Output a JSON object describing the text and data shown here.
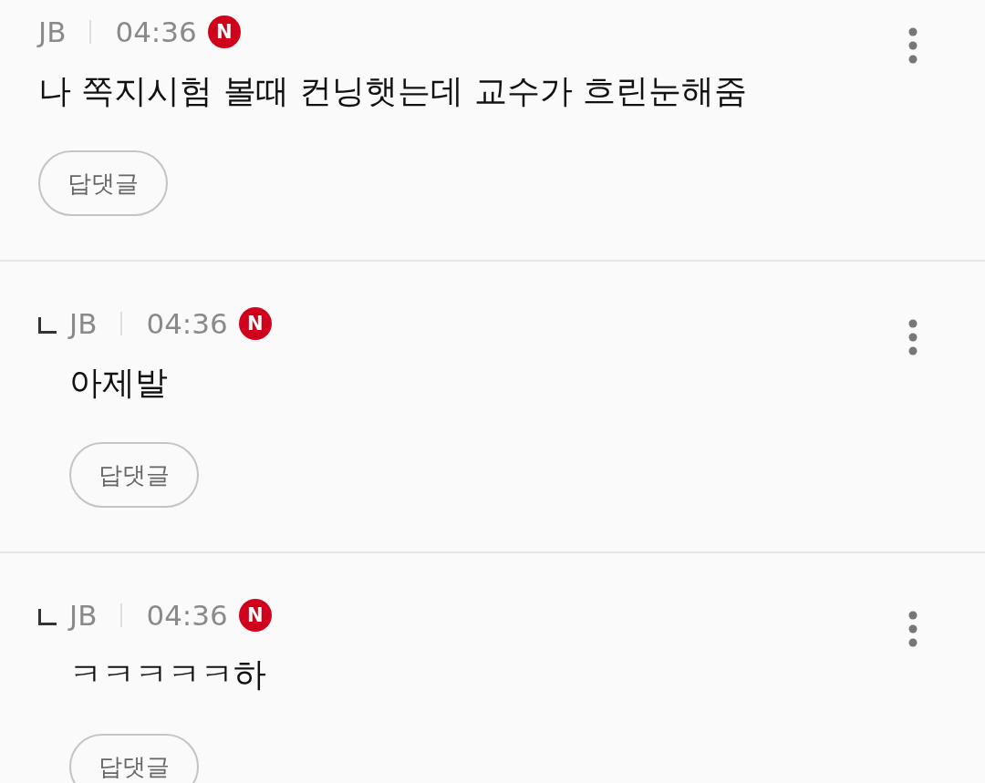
{
  "comments": [
    {
      "reply": false,
      "author": "JB",
      "time": "04:36",
      "badge": "N",
      "text": "나 쪽지시험 볼때 컨닝햇는데 교수가 흐린눈해줌",
      "button": "답댓글"
    },
    {
      "reply": true,
      "author": "JB",
      "time": "04:36",
      "badge": "N",
      "text": "아제발",
      "button": "답댓글"
    },
    {
      "reply": true,
      "author": "JB",
      "time": "04:36",
      "badge": "N",
      "text": "ㅋㅋㅋㅋㅋ하",
      "button": "답댓글"
    }
  ]
}
